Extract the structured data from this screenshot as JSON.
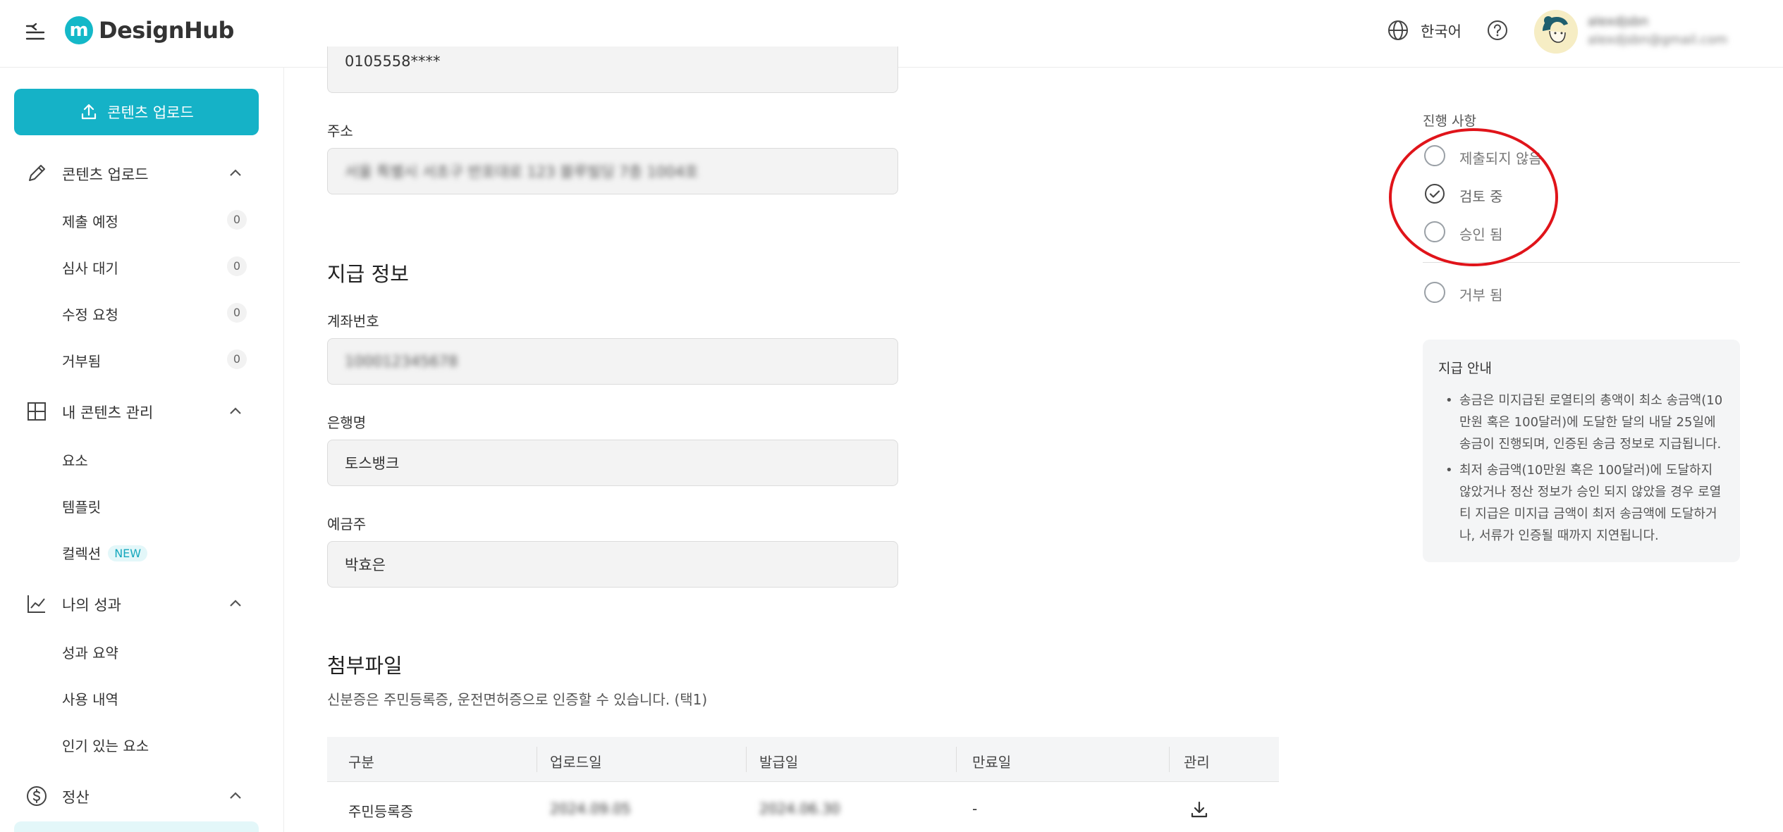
{
  "header": {
    "logo_letter": "m",
    "logo_text": "DesignHub",
    "language": "한국어",
    "user_name": "alexdjsbn",
    "user_email": "alexdjsbn@gmail.com"
  },
  "sidebar": {
    "upload_button": "콘텐츠 업로드",
    "sections": [
      {
        "label": "콘텐츠 업로드",
        "icon": "pencil-icon",
        "items": [
          {
            "label": "제출 예정",
            "count": "0"
          },
          {
            "label": "심사 대기",
            "count": "0"
          },
          {
            "label": "수정 요청",
            "count": "0"
          },
          {
            "label": "거부됨",
            "count": "0"
          }
        ]
      },
      {
        "label": "내 콘텐츠 관리",
        "icon": "layout-icon",
        "items": [
          {
            "label": "요소"
          },
          {
            "label": "템플릿"
          },
          {
            "label": "컬렉션",
            "badge": "NEW"
          }
        ]
      },
      {
        "label": "나의 성과",
        "icon": "chart-line-icon",
        "items": [
          {
            "label": "성과 요약"
          },
          {
            "label": "사용 내역"
          },
          {
            "label": "인기 있는 요소"
          }
        ]
      },
      {
        "label": "정산",
        "icon": "dollar-circle-icon",
        "items": []
      }
    ]
  },
  "form": {
    "phone_value": "0105558****",
    "address_label": "주소",
    "address_value": "서울 특별시 서초구 반포대로 123 블루빌딩 7층 1004호",
    "payment_section_title": "지급 정보",
    "account_label": "계좌번호",
    "account_value": "100012345678",
    "bank_label": "은행명",
    "bank_value": "토스뱅크",
    "holder_label": "예금주",
    "holder_value": "박효은"
  },
  "attachments": {
    "title": "첨부파일",
    "description": "신분증은 주민등록증, 운전면허증으로 인증할 수 있습니다. (택1)",
    "columns": [
      "구분",
      "업로드일",
      "발급일",
      "만료일",
      "관리"
    ],
    "rows": [
      {
        "type": "주민등록증",
        "uploaded": "2024.09.05",
        "issued": "2024.06.30",
        "expires": "-"
      }
    ]
  },
  "status": {
    "title": "진행 사항",
    "options": [
      {
        "label": "제출되지 않음",
        "checked": false
      },
      {
        "label": "검토 중",
        "checked": true
      },
      {
        "label": "승인 됨",
        "checked": false
      },
      {
        "label": "거부 됨",
        "checked": false
      }
    ]
  },
  "guide": {
    "title": "지급 안내",
    "items": [
      "송금은 미지급된 로열티의 총액이 최소 송금액(10만원 혹은 100달러)에 도달한 달의 내달 25일에 송금이 진행되며, 인증된 송금 정보로 지급됩니다.",
      "최저 송금액(10만원 혹은 100달러)에 도달하지 않았거나 정산 정보가 승인 되지 않았을 경우 로열티 지급은 미지급 금액이 최저 송금액에 도달하거나, 서류가 인증될 때까지 지연됩니다."
    ]
  },
  "colors": {
    "accent": "#15b2c7",
    "highlight": "#e0141a"
  }
}
